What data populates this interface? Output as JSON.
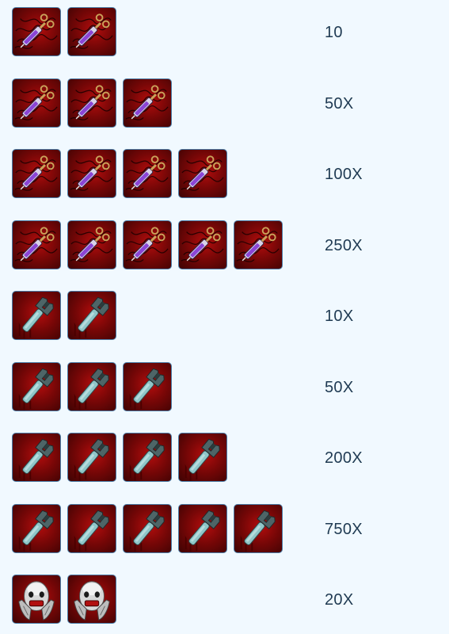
{
  "rows": [
    {
      "item": "syringe-icon",
      "icon_count": 2,
      "amount": "10"
    },
    {
      "item": "syringe-icon",
      "icon_count": 3,
      "amount": "50X"
    },
    {
      "item": "syringe-icon",
      "icon_count": 4,
      "amount": "100X"
    },
    {
      "item": "syringe-icon",
      "icon_count": 5,
      "amount": "250X"
    },
    {
      "item": "pipe-wrench-icon",
      "icon_count": 2,
      "amount": "10X"
    },
    {
      "item": "pipe-wrench-icon",
      "icon_count": 3,
      "amount": "50X"
    },
    {
      "item": "pipe-wrench-icon",
      "icon_count": 4,
      "amount": "200X"
    },
    {
      "item": "pipe-wrench-icon",
      "icon_count": 5,
      "amount": "750X"
    },
    {
      "item": "screaming-mask-icon",
      "icon_count": 2,
      "amount": "20X"
    }
  ],
  "colors": {
    "background": "#f1f9ff",
    "text": "#1f3a52",
    "icon_border": "#4a7da8",
    "icon_red": "#b30d0d"
  }
}
